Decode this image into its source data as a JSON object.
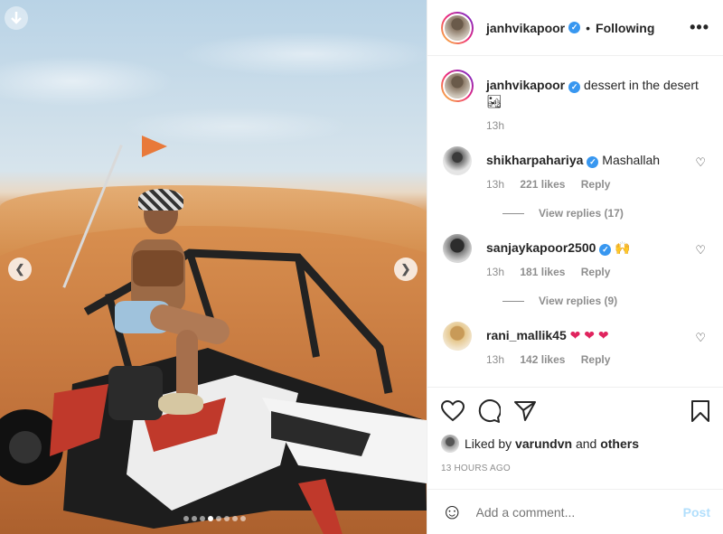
{
  "post": {
    "author": "janhvikapoor",
    "follow_sep": "•",
    "follow_status": "Following",
    "more": "•••",
    "caption_author": "janhvikapoor",
    "caption_text": "dessert in the desert 🏜",
    "caption_time": "13h",
    "carousel": {
      "total": 8,
      "active": 3
    },
    "icons": {
      "download": "download-arrow-icon",
      "prev": "chevron-left-icon",
      "next": "chevron-right-icon"
    }
  },
  "comments": [
    {
      "user": "shikharpahariya",
      "verified": true,
      "text": "Mashallah",
      "time": "13h",
      "likes": "221 likes",
      "reply": "Reply",
      "replies": "View replies (17)"
    },
    {
      "user": "sanjaykapoor2500",
      "verified": true,
      "text": "🙌",
      "time": "13h",
      "likes": "181 likes",
      "reply": "Reply",
      "replies": "View replies (9)"
    },
    {
      "user": "rani_mallik45",
      "verified": false,
      "text": "❤ ❤ ❤",
      "time": "13h",
      "likes": "142 likes",
      "reply": "Reply"
    }
  ],
  "actions": {
    "liked_prefix": "Liked by",
    "liked_user": "varundvn",
    "liked_and": "and",
    "liked_others": "others",
    "timestamp": "13 hours ago"
  },
  "add_comment": {
    "placeholder": "Add a comment...",
    "post_label": "Post"
  },
  "colors": {
    "verified": "#3897f0",
    "post_disabled": "#b2dffc",
    "meta": "#8e8e8e",
    "heart_emoji": "#e0245e"
  }
}
